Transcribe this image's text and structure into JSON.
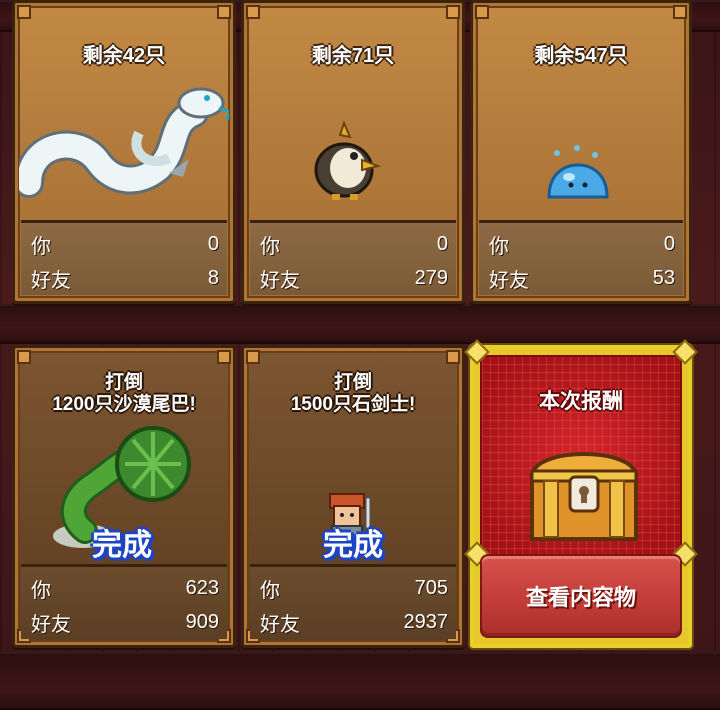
{
  "cards": [
    {
      "remaining": "剩余42只",
      "you_label": "你",
      "you_value": "0",
      "friend_label": "好友",
      "friend_value": "8",
      "creature_icon": "white-serpent-icon"
    },
    {
      "remaining": "剩余71只",
      "you_label": "你",
      "you_value": "0",
      "friend_label": "好友",
      "friend_value": "279",
      "creature_icon": "crested-bird-icon"
    },
    {
      "remaining": "剩余547只",
      "you_label": "你",
      "you_value": "0",
      "friend_label": "好友",
      "friend_value": "53",
      "creature_icon": "blue-slime-icon"
    },
    {
      "mission_line1": "打倒",
      "mission_line2": "1200只沙漠尾巴!",
      "status": "完成",
      "you_label": "你",
      "you_value": "623",
      "friend_label": "好友",
      "friend_value": "909",
      "creature_icon": "green-plant-tail-icon"
    },
    {
      "mission_line1": "打倒",
      "mission_line2": "1500只石剑士!",
      "status": "完成",
      "you_label": "你",
      "you_value": "705",
      "friend_label": "好友",
      "friend_value": "2937",
      "creature_icon": "stone-swordsman-icon"
    }
  ],
  "reward": {
    "title": "本次报酬",
    "button_label": "查看内容物",
    "chest_icon": "treasure-chest-icon"
  },
  "colors": {
    "card_border": "#b07434",
    "reward_gold": "#e8cf2a",
    "reward_red": "#b2171b",
    "done_blue": "#1b45c4"
  }
}
